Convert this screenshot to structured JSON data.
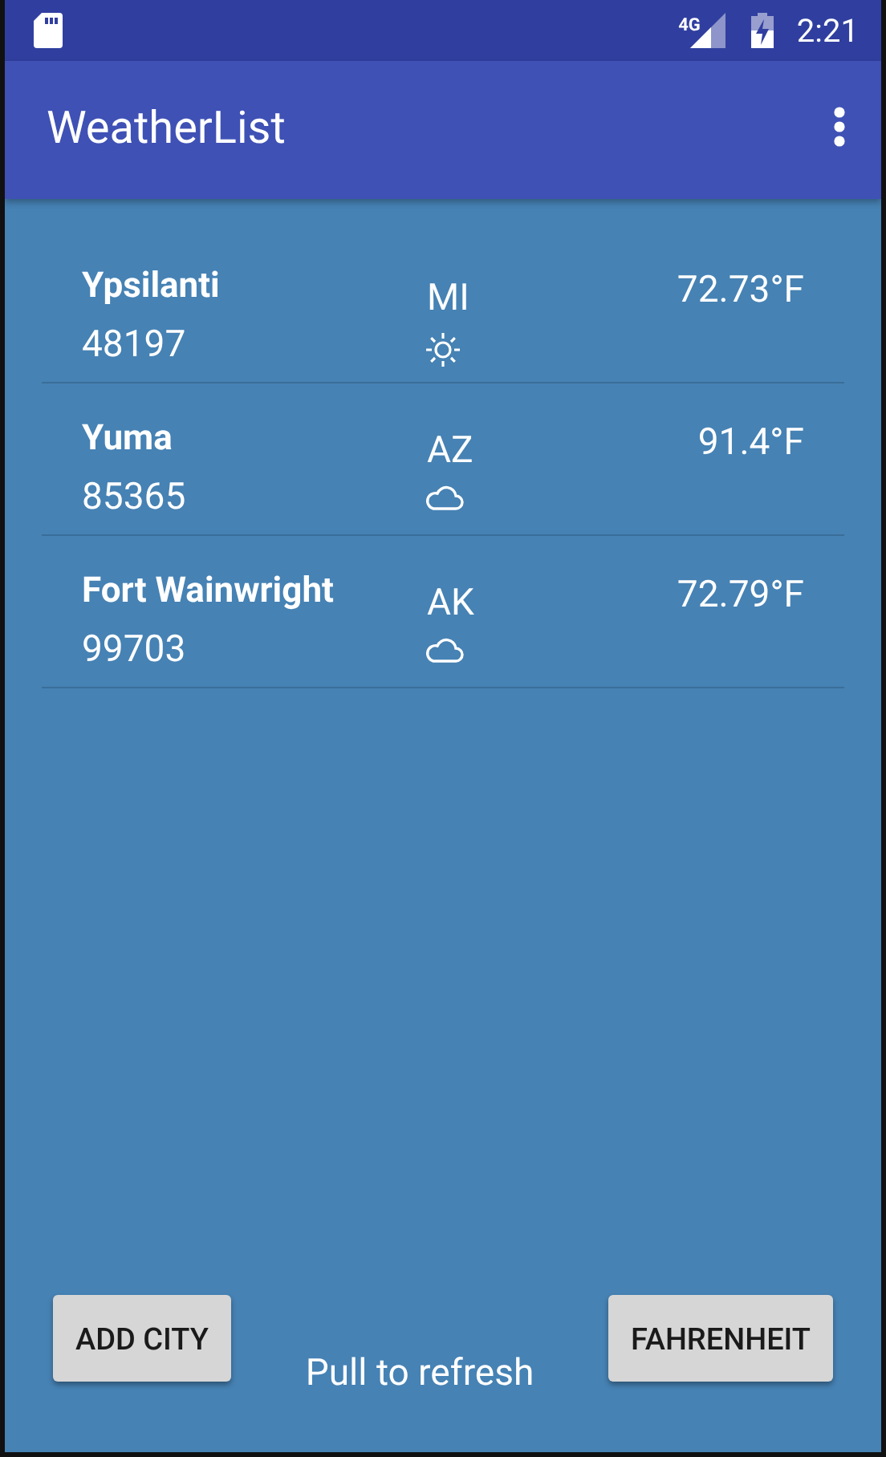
{
  "status_bar": {
    "network": "4G",
    "time": "2:21"
  },
  "app_bar": {
    "title": "WeatherList"
  },
  "cities": [
    {
      "name": "Ypsilanti",
      "zip": "48197",
      "state": "MI",
      "temperature": "72.73°F",
      "kind": "sunny"
    },
    {
      "name": "Yuma",
      "zip": "85365",
      "state": "AZ",
      "temperature": "91.4°F",
      "kind": "cloudy"
    },
    {
      "name": "Fort Wainwright",
      "zip": "99703",
      "state": "AK",
      "temperature": "72.79°F",
      "kind": "cloudy"
    }
  ],
  "footer": {
    "add_button": "ADD CITY",
    "hint": "Pull to refresh",
    "unit_button": "FAHRENHEIT"
  }
}
